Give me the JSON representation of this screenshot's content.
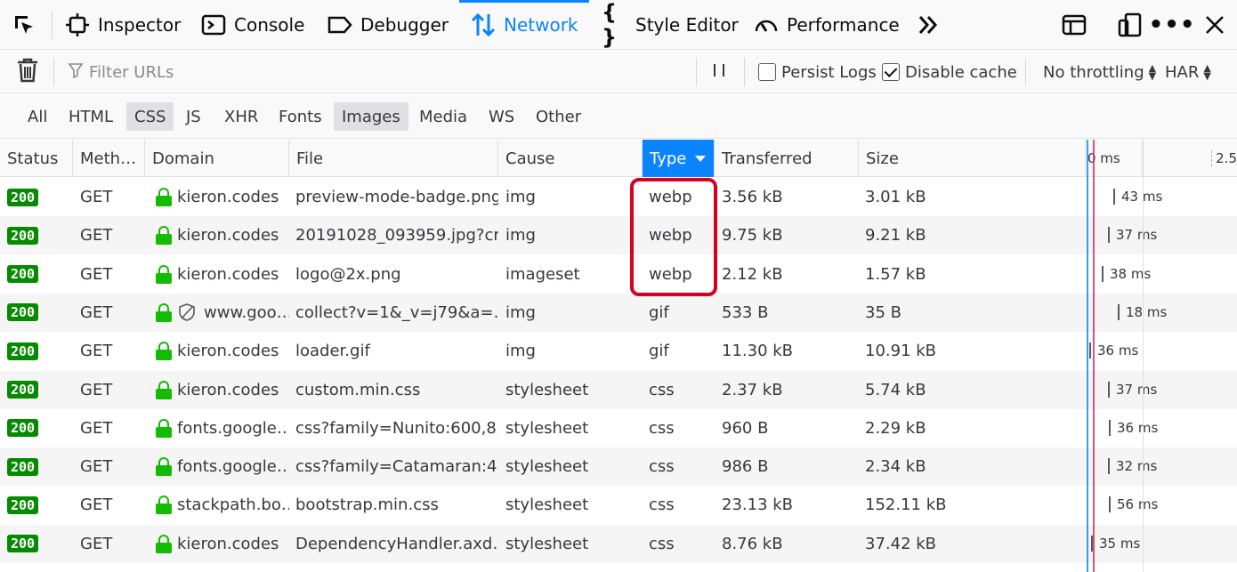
{
  "toolbar": {
    "tabs": [
      {
        "label": "Inspector",
        "icon": "inspector-icon"
      },
      {
        "label": "Console",
        "icon": "console-icon"
      },
      {
        "label": "Debugger",
        "icon": "debugger-icon"
      },
      {
        "label": "Network",
        "icon": "network-icon",
        "selected": true
      },
      {
        "label": "Style Editor",
        "icon": "style-editor-icon"
      },
      {
        "label": "Performance",
        "icon": "performance-icon"
      }
    ]
  },
  "filterbar": {
    "filter_placeholder": "Filter URLs",
    "persist_logs_label": "Persist Logs",
    "persist_logs_checked": false,
    "disable_cache_label": "Disable cache",
    "disable_cache_checked": true,
    "throttling_value": "No throttling",
    "har_label": "HAR"
  },
  "type_filters": [
    {
      "label": "All",
      "active": false
    },
    {
      "label": "HTML",
      "active": false
    },
    {
      "label": "CSS",
      "active": true
    },
    {
      "label": "JS",
      "active": false
    },
    {
      "label": "XHR",
      "active": false
    },
    {
      "label": "Fonts",
      "active": false
    },
    {
      "label": "Images",
      "active": true
    },
    {
      "label": "Media",
      "active": false
    },
    {
      "label": "WS",
      "active": false
    },
    {
      "label": "Other",
      "active": false
    }
  ],
  "columns": {
    "status": "Status",
    "method": "Meth…",
    "domain": "Domain",
    "file": "File",
    "cause": "Cause",
    "type": "Type",
    "transferred": "Transferred",
    "size": "Size",
    "waterfall_tick_0": "0 ms",
    "waterfall_tick_1": "2.5"
  },
  "rows": [
    {
      "status": "200",
      "method": "GET",
      "domain": "kieron.codes",
      "tracker": false,
      "file": "preview-mode-badge.png",
      "cause": "img",
      "type": "webp",
      "transferred": "3.56 kB",
      "size": "3.01 kB",
      "time": "43 ms"
    },
    {
      "status": "200",
      "method": "GET",
      "domain": "kieron.codes",
      "tracker": false,
      "file": "20191028_093959.jpg?cr…",
      "cause": "img",
      "type": "webp",
      "transferred": "9.75 kB",
      "size": "9.21 kB",
      "time": "37 ms"
    },
    {
      "status": "200",
      "method": "GET",
      "domain": "kieron.codes",
      "tracker": false,
      "file": "logo@2x.png",
      "cause": "imageset",
      "type": "webp",
      "transferred": "2.12 kB",
      "size": "1.57 kB",
      "time": "38 ms"
    },
    {
      "status": "200",
      "method": "GET",
      "domain": "www.goo…",
      "tracker": true,
      "file": "collect?v=1&_v=j79&a=…",
      "cause": "img",
      "type": "gif",
      "transferred": "533 B",
      "size": "35 B",
      "time": "18 ms"
    },
    {
      "status": "200",
      "method": "GET",
      "domain": "kieron.codes",
      "tracker": false,
      "file": "loader.gif",
      "cause": "img",
      "type": "gif",
      "transferred": "11.30 kB",
      "size": "10.91 kB",
      "time": "36 ms"
    },
    {
      "status": "200",
      "method": "GET",
      "domain": "kieron.codes",
      "tracker": false,
      "file": "custom.min.css",
      "cause": "stylesheet",
      "type": "css",
      "transferred": "2.37 kB",
      "size": "5.74 kB",
      "time": "37 ms"
    },
    {
      "status": "200",
      "method": "GET",
      "domain": "fonts.google…",
      "tracker": false,
      "file": "css?family=Nunito:600,8…",
      "cause": "stylesheet",
      "type": "css",
      "transferred": "960 B",
      "size": "2.29 kB",
      "time": "36 ms"
    },
    {
      "status": "200",
      "method": "GET",
      "domain": "fonts.google…",
      "tracker": false,
      "file": "css?family=Catamaran:4…",
      "cause": "stylesheet",
      "type": "css",
      "transferred": "986 B",
      "size": "2.34 kB",
      "time": "32 ms"
    },
    {
      "status": "200",
      "method": "GET",
      "domain": "stackpath.bo…",
      "tracker": false,
      "file": "bootstrap.min.css",
      "cause": "stylesheet",
      "type": "css",
      "transferred": "23.13 kB",
      "size": "152.11 kB",
      "time": "56 ms"
    },
    {
      "status": "200",
      "method": "GET",
      "domain": "kieron.codes",
      "tracker": false,
      "file": "DependencyHandler.axd…",
      "cause": "stylesheet",
      "type": "css",
      "transferred": "8.76 kB",
      "size": "37.42 kB",
      "time": "35 ms"
    }
  ],
  "colors": {
    "accent": "#0a84ff",
    "status_ok": "#058b00",
    "secure_lock": "#12bc00",
    "highlight_box": "#d70022"
  }
}
